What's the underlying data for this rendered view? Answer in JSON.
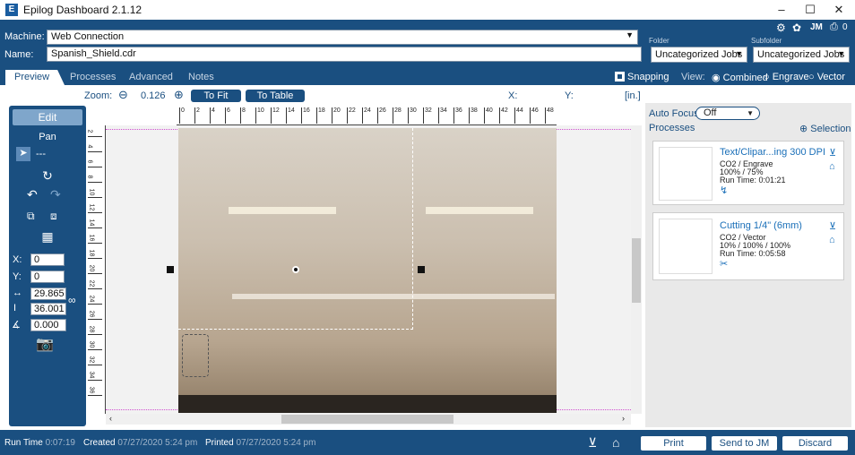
{
  "window": {
    "title": "Epilog Dashboard 2.1.12",
    "logo": "E",
    "minimize": "–",
    "maximize": "☐",
    "close": "✕"
  },
  "header": {
    "machine_label": "Machine:",
    "machine_value": "Web Connection",
    "name_label": "Name:",
    "name_value": "Spanish_Shield.cdr",
    "folder_label": "Folder",
    "folder_value": "Uncategorized Jobs",
    "subfolder_label": "Subfolder",
    "subfolder_value": "Uncategorized Jobs",
    "user_initials": "JM",
    "job_count": "0"
  },
  "tabs": [
    "Preview",
    "Processes",
    "Advanced",
    "Notes"
  ],
  "view": {
    "snapping_label": "Snapping",
    "view_label": "View:",
    "options": [
      "Combined",
      "Engrave",
      "Vector"
    ],
    "selected": "Combined"
  },
  "zoom": {
    "label": "Zoom:",
    "value": "0.126",
    "to_fit": "To Fit",
    "to_table": "To Table",
    "x_label": "X:",
    "y_label": "Y:",
    "unit": "[in.]"
  },
  "left_panel": {
    "edit": "Edit",
    "pan": "Pan",
    "pointer_value": "---",
    "x_label": "X:",
    "x_value": "0",
    "y_label": "Y:",
    "y_value": "0",
    "width_value": "29.865",
    "height_value": "36.001",
    "angle_value": "0.000"
  },
  "hruler": [
    "0",
    "2",
    "4",
    "6",
    "8",
    "10",
    "12",
    "14",
    "16",
    "18",
    "20",
    "22",
    "24",
    "26",
    "28",
    "30",
    "32",
    "34",
    "36",
    "38",
    "40",
    "42",
    "44",
    "46",
    "48"
  ],
  "vruler": [
    "2",
    "4",
    "6",
    "8",
    "10",
    "12",
    "14",
    "16",
    "18",
    "20",
    "22",
    "24",
    "26",
    "28",
    "30",
    "32",
    "34",
    "36"
  ],
  "right_panel": {
    "autofocus_label": "Auto Focus",
    "autofocus_value": "Off",
    "processes_label": "Processes",
    "selection_label": "Selection",
    "processes": [
      {
        "title": "Text/Clipar...ing 300 DPI",
        "line1": "CO2 / Engrave",
        "line2": "100% / 75%",
        "line3": "Run Time: 0:01:21"
      },
      {
        "title": "Cutting 1/4\" (6mm)",
        "line1": "CO2 / Vector",
        "line2": "10% / 100% / 100%",
        "line3": "Run Time: 0:05:58"
      }
    ]
  },
  "footer": {
    "run_time_label": "Run Time",
    "run_time_value": "0:07:19",
    "created_label": "Created",
    "created_value": "07/27/2020 5:24 pm",
    "printed_label": "Printed",
    "printed_value": "07/27/2020 5:24 pm",
    "print": "Print",
    "send": "Send to JM",
    "discard": "Discard"
  },
  "colors": {
    "primary": "#1a4f80",
    "accent": "#1a6fb8"
  }
}
